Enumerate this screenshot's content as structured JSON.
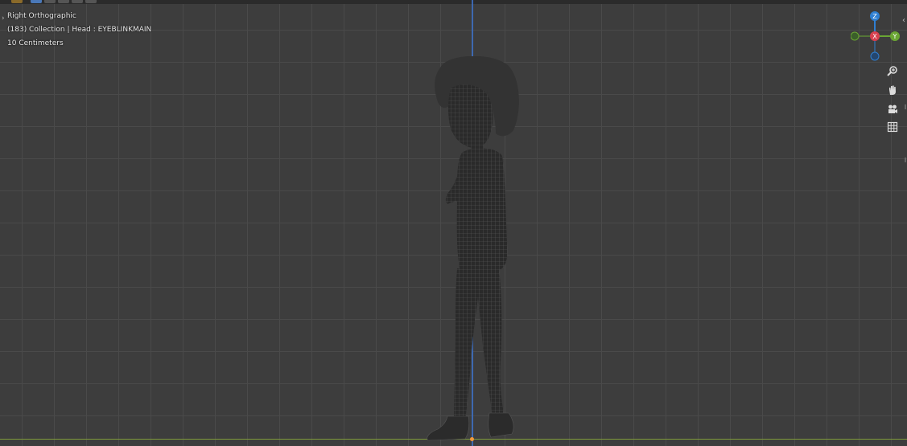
{
  "viewport": {
    "view_name": "Right Orthographic",
    "context_info": "(183) Collection | Head : EYEBLINKMAIN",
    "grid_scale": "10 Centimeters"
  },
  "gizmo": {
    "z_label": "Z",
    "x_label": "X",
    "y_label": "Y",
    "colors": {
      "z": "#2f7fd1",
      "x": "#d8404f",
      "y": "#6aa533",
      "neg": "#3b5f2a"
    }
  },
  "side_toolbar": [
    {
      "name": "zoom",
      "icon": "zoom-icon"
    },
    {
      "name": "pan",
      "icon": "hand-icon"
    },
    {
      "name": "camera",
      "icon": "camera-icon"
    },
    {
      "name": "perspective",
      "icon": "grid-icon"
    }
  ],
  "colors": {
    "background": "#3d3d3d",
    "grid": "#4a4a4a",
    "z_axis": "#3d6dbd",
    "y_axis": "#7f9b3c",
    "origin": "#f39a3a"
  }
}
